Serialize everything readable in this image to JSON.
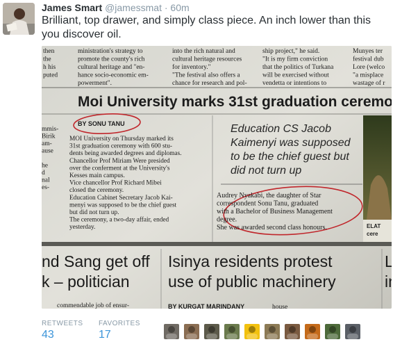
{
  "tweet": {
    "author_name": "James Smart",
    "handle": "@jamessmat",
    "separator": "·",
    "time": "60m",
    "text": "Brilliant, top drawer, and simply class piece. An inch lower than this you discover oil."
  },
  "stats": {
    "retweets_label": "RETWEETS",
    "retweets_count": "43",
    "favorites_label": "FAVORITES",
    "favorites_count": "17"
  },
  "favorited_by": {
    "avatar_colors": [
      "#6f6a63",
      "#8a6d52",
      "#5c5a4a",
      "#6a7a4c",
      "#f2c10f",
      "#8c7a55",
      "#7a5a40",
      "#c46a1a",
      "#4d6a3a",
      "#5a5f66"
    ]
  },
  "newspaper": {
    "top_col1": [
      "then",
      "the",
      "h his",
      "puted"
    ],
    "top_col2": [
      "ministration's strategy to",
      "promote the county's rich",
      "cultural heritage and \"en-",
      "hance socio-economic em-",
      "powerment\"."
    ],
    "top_col3": [
      "into the rich natural and",
      "cultural heritage resources",
      "for inventory.\"",
      "\"The festival also offers a",
      "chance for research and pol-"
    ],
    "top_col4": [
      "ship project,\" he said.",
      "\"It is my firm conviction",
      "that the politics of Turkana",
      "will be exercised without",
      "vendetta or intentions to"
    ],
    "top_col5": [
      "Munyes ter",
      "festival dub",
      "Lore (welco",
      "\"a misplace",
      "wastage of r"
    ],
    "headline": "Moi University marks 31st graduation ceremo",
    "byline": "BY SONU TANU",
    "left_edge": [
      "mmis-",
      "Birik",
      "am-",
      "ause",
      "",
      "he",
      "d",
      "nal",
      "es-"
    ],
    "body": [
      "MOI University on Thursday marked its",
      "31st graduation ceremony with 600 stu-",
      "dents being awarded degrees and diplomas.",
      "Chancellor Prof Miriam Were presided",
      "over the conferment at the University's",
      "Kesses main campus.",
      "Vice chancellor Prof Richard Mibei",
      "closed the ceremony.",
      "Education Cabinet Secretary Jacob Kai-",
      "menyi was supposed to be the chief guest",
      "but did not turn up.",
      "The ceremony, a two-day affair, ended",
      "yesterday."
    ],
    "pullquote": [
      "Education CS Jacob",
      "Kaimenyi was supposed",
      "to be the chief guest but",
      "did not turn up"
    ],
    "caption": [
      "Audrey Nyakabi, the daughter of Star",
      "correspondent Sonu Tanu, graduated",
      "with a Bachelor of Business Management",
      "degree.",
      "She was awarded second class honours."
    ],
    "right_edge": [
      "ELAT",
      "cere"
    ],
    "lower_left": [
      "nd Sang get off",
      "k – politician"
    ],
    "lower_mid": [
      "Isinya residents protest",
      "use of public machinery"
    ],
    "lower_right": [
      "La",
      "in"
    ],
    "bottom_left": "commendable job of ensur-",
    "bottom_byline": "BY KURGAT MARINDANY",
    "bottom_frag": "house"
  }
}
